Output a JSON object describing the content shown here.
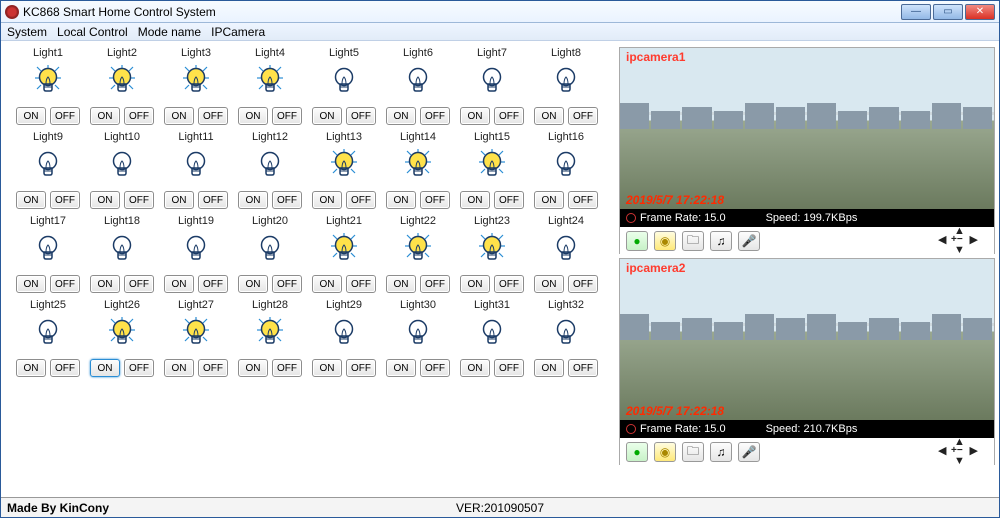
{
  "window": {
    "title": "KC868 Smart Home Control System"
  },
  "menu": [
    "System",
    "Local Control",
    "Mode name",
    "IPCamera"
  ],
  "buttons": {
    "on": "ON",
    "off": "OFF"
  },
  "lights": [
    {
      "label": "Light1",
      "on": true
    },
    {
      "label": "Light2",
      "on": true
    },
    {
      "label": "Light3",
      "on": true
    },
    {
      "label": "Light4",
      "on": true
    },
    {
      "label": "Light5",
      "on": false
    },
    {
      "label": "Light6",
      "on": false
    },
    {
      "label": "Light7",
      "on": false
    },
    {
      "label": "Light8",
      "on": false
    },
    {
      "label": "Light9",
      "on": false
    },
    {
      "label": "Light10",
      "on": false
    },
    {
      "label": "Light11",
      "on": false
    },
    {
      "label": "Light12",
      "on": false
    },
    {
      "label": "Light13",
      "on": true
    },
    {
      "label": "Light14",
      "on": true
    },
    {
      "label": "Light15",
      "on": true
    },
    {
      "label": "Light16",
      "on": false
    },
    {
      "label": "Light17",
      "on": false
    },
    {
      "label": "Light18",
      "on": false
    },
    {
      "label": "Light19",
      "on": false
    },
    {
      "label": "Light20",
      "on": false
    },
    {
      "label": "Light21",
      "on": true
    },
    {
      "label": "Light22",
      "on": true
    },
    {
      "label": "Light23",
      "on": true
    },
    {
      "label": "Light24",
      "on": false
    },
    {
      "label": "Light25",
      "on": false
    },
    {
      "label": "Light26",
      "on": true
    },
    {
      "label": "Light27",
      "on": true
    },
    {
      "label": "Light28",
      "on": true
    },
    {
      "label": "Light29",
      "on": false
    },
    {
      "label": "Light30",
      "on": false
    },
    {
      "label": "Light31",
      "on": false
    },
    {
      "label": "Light32",
      "on": false
    }
  ],
  "selected_on_button_index": 25,
  "cameras": [
    {
      "label": "ipcamera1",
      "timestamp": "2019/5/7 17:22:18",
      "frame_rate": "Frame Rate: 15.0",
      "speed": "Speed:  199.7KBps"
    },
    {
      "label": "ipcamera2",
      "timestamp": "2019/5/7 17:22:18",
      "frame_rate": "Frame Rate: 15.0",
      "speed": "Speed:  210.7KBps"
    }
  ],
  "footer": {
    "made_by": "Made By KinCony",
    "version": "VER:201090507"
  }
}
